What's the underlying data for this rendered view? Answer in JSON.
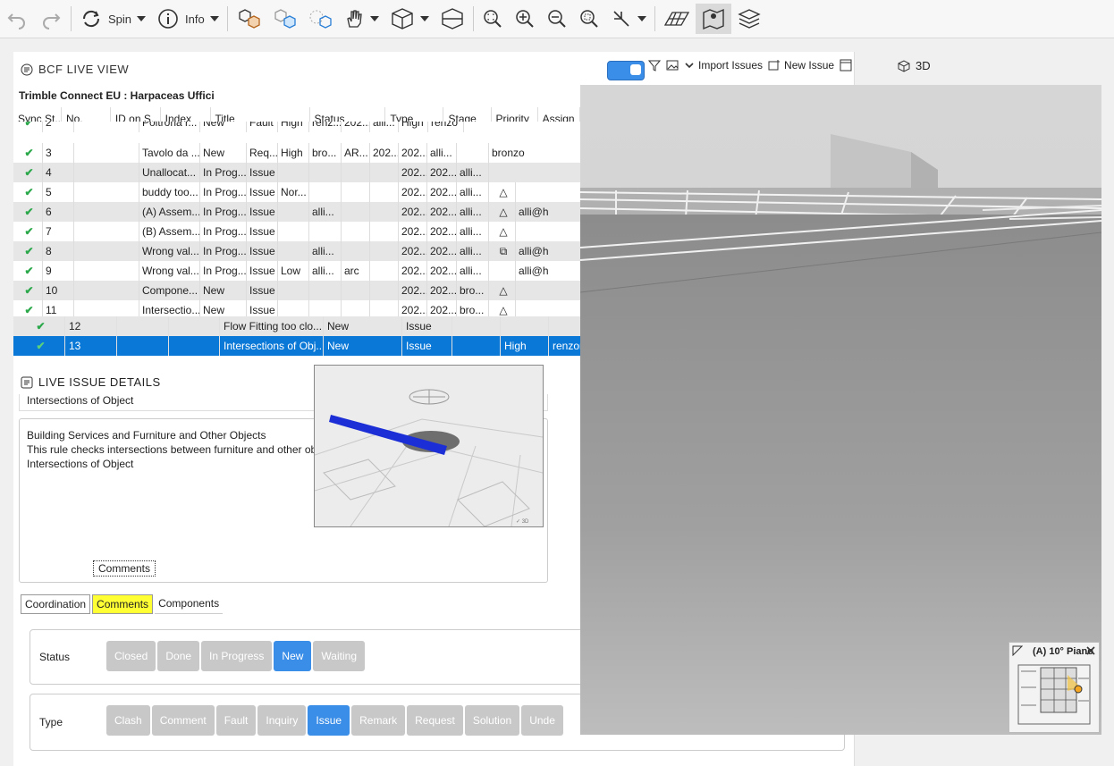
{
  "toolbar": {
    "spin_label": "Spin",
    "info_label": "Info"
  },
  "bcf": {
    "panel_title": "BCF LIVE VIEW",
    "project": "Trimble Connect EU : Harpaceas Uffici",
    "import_label": "Import Issues",
    "new_issue_label": "New Issue",
    "columns": [
      "Sync St...",
      "No.",
      "ID on S...",
      "Index",
      "Title",
      "Status",
      "Type",
      "Stage",
      "Priority",
      "Assign"
    ],
    "rows": [
      {
        "no": "2",
        "title": "Poltrona r...",
        "status": "New",
        "type": "Fault",
        "prio": "High",
        "c1": "renz...",
        "c2": "202...",
        "c3": "alli...",
        "c4": "High",
        "assign": "renzo"
      },
      {
        "no": "3",
        "title": "Tavolo da ...",
        "status": "New",
        "type": "Req...",
        "prio": "High",
        "c1": "bro...",
        "c2": "AR...",
        "c3": "202...",
        "c4": "202...",
        "c5": "alli...",
        "assign": "bronzo"
      },
      {
        "no": "4",
        "title": "Unallocat...",
        "status": "In Prog...",
        "type": "Issue",
        "prio": "",
        "c1": "",
        "c2": "",
        "c3": "",
        "c4": "202...",
        "c5": "202...",
        "c6": "alli...",
        "assign": ""
      },
      {
        "no": "5",
        "title": "buddy too...",
        "status": "In Prog...",
        "type": "Issue",
        "prio": "Nor...",
        "c1": "",
        "c2": "",
        "c3": "",
        "c4": "202...",
        "c5": "202...",
        "c6": "alli...",
        "assign": ""
      },
      {
        "no": "6",
        "title": "(A) Assem...",
        "status": "In Prog...",
        "type": "Issue",
        "prio": "",
        "c1": "alli...",
        "c2": "",
        "c3": "",
        "c4": "202...",
        "c5": "202...",
        "c6": "alli...",
        "assign": "alli@h"
      },
      {
        "no": "7",
        "title": "(B) Assem...",
        "status": "In Prog...",
        "type": "Issue",
        "prio": "",
        "c1": "",
        "c2": "",
        "c3": "",
        "c4": "202...",
        "c5": "202...",
        "c6": "alli...",
        "assign": ""
      },
      {
        "no": "8",
        "title": "Wrong val...",
        "status": "In Prog...",
        "type": "Issue",
        "prio": "",
        "c1": "alli...",
        "c2": "",
        "c3": "",
        "c4": "202...",
        "c5": "202...",
        "c6": "alli...",
        "assign": "alli@h"
      },
      {
        "no": "9",
        "title": "Wrong val...",
        "status": "In Prog...",
        "type": "Issue",
        "prio": "Low",
        "c1": "alli...",
        "c2": "arc",
        "c3": "",
        "c4": "202...",
        "c5": "202...",
        "c6": "alli...",
        "assign": "alli@h"
      },
      {
        "no": "10",
        "title": "Compone...",
        "status": "New",
        "type": "Issue",
        "prio": "",
        "c1": "",
        "c2": "",
        "c3": "",
        "c4": "202...",
        "c5": "202...",
        "c6": "bro...",
        "assign": ""
      },
      {
        "no": "11",
        "title": "Intersectio...",
        "status": "New",
        "type": "Issue",
        "prio": "",
        "c1": "",
        "c2": "",
        "c3": "",
        "c4": "202...",
        "c5": "202...",
        "c6": "bro...",
        "assign": ""
      }
    ],
    "row12": {
      "no": "12",
      "title": "Flow Fitting too clo...",
      "status": "New",
      "type": "Issue"
    },
    "row13": {
      "no": "13",
      "title": "Intersections of Obj...",
      "status": "New",
      "type": "Issue",
      "prio": "High",
      "assign": "renzon"
    }
  },
  "details": {
    "panel_title": "LIVE ISSUE DETAILS",
    "title_text": "Intersections of Object",
    "desc_line1": "Building Services and Furniture and Other Objects",
    "desc_line2": "This rule checks intersections between furniture and other ob",
    "desc_line3": "Intersections of Object",
    "comments_btn": "Comments",
    "tabs": [
      "Coordination",
      "Comments",
      "Components"
    ],
    "status_label": "Status",
    "status_opts": [
      "Closed",
      "Done",
      "In Progress",
      "New",
      "Waiting"
    ],
    "type_label": "Type",
    "type_opts": [
      "Clash",
      "Comment",
      "Fault",
      "Inquiry",
      "Issue",
      "Remark",
      "Request",
      "Solution",
      "Unde"
    ]
  },
  "viewer": {
    "mode_label": "3D",
    "minimap_title": "(A) 10° Piano"
  },
  "colors": {
    "accent": "#3b8ee8",
    "selected_row": "#0a78d7",
    "check": "#2aa84a",
    "highlight": "#ffff33"
  }
}
